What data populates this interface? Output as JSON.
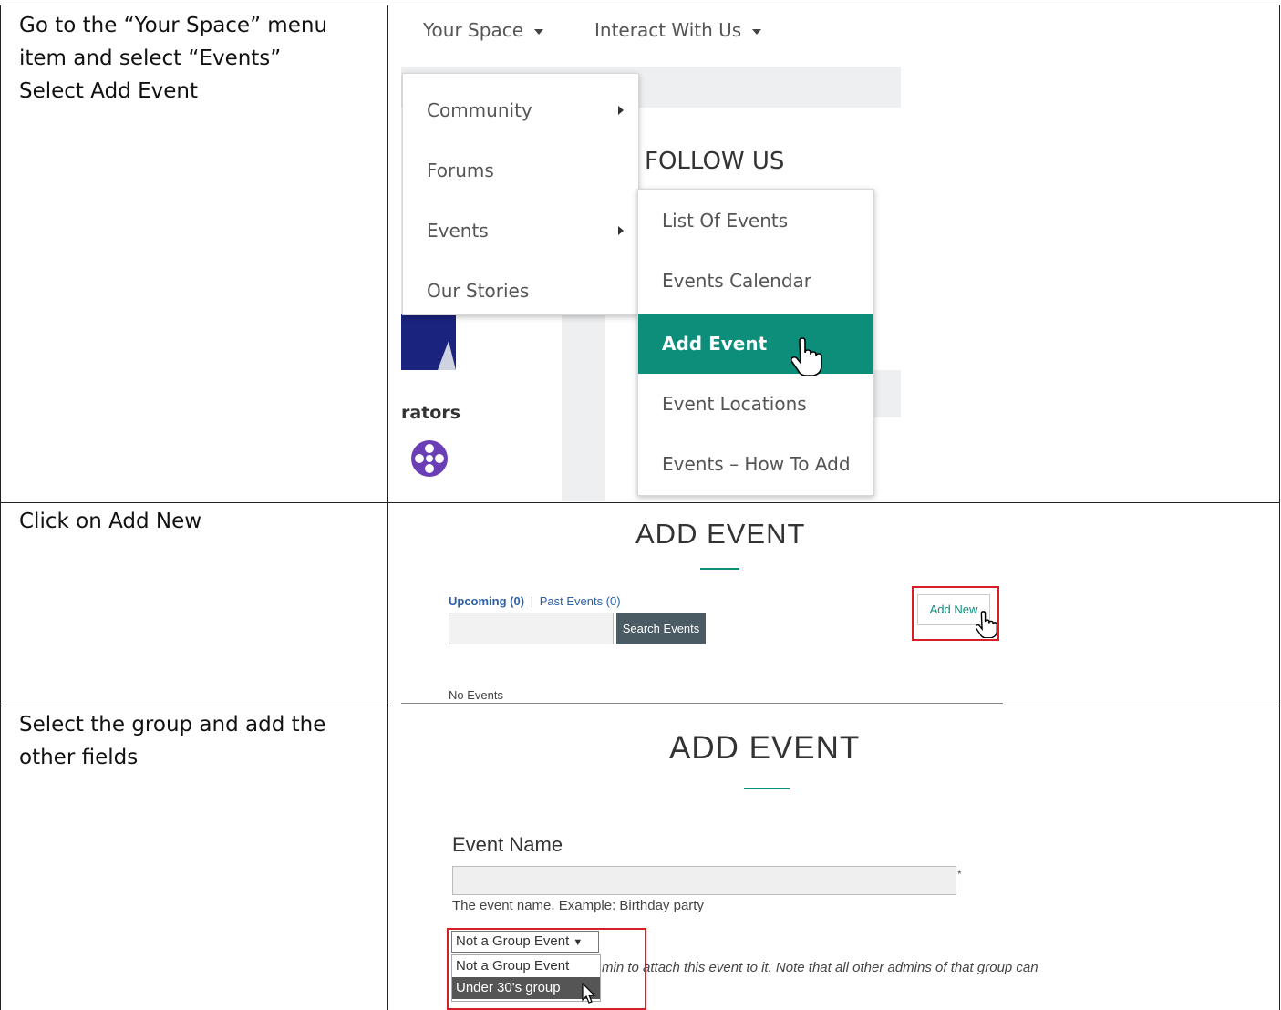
{
  "instructions": {
    "step1": [
      "Go to the “Your Space” menu",
      "item and select “Events”",
      "Select Add Event"
    ],
    "step2": "Click on Add New",
    "step3": [
      "Select the group and add the",
      "other fields"
    ]
  },
  "screenshot1": {
    "nav": {
      "your_space": "Your Space",
      "interact": "Interact With Us"
    },
    "menu": [
      "Community",
      "Forums",
      "Events",
      "Our Stories"
    ],
    "follow_us": "FOLLOW US",
    "background_text": "rators",
    "submenu": [
      "List Of Events",
      "Events Calendar",
      "Add Event",
      "Event Locations",
      "Events – How To Add"
    ],
    "colors": {
      "active": "#0d8e7b",
      "highlight": "#d61f26"
    }
  },
  "screenshot2": {
    "title": "ADD EVENT",
    "upcoming": "Upcoming (0)",
    "separator": "|",
    "past": "Past Events (0)",
    "search_button": "Search Events",
    "add_new": "Add New",
    "no_events": "No Events"
  },
  "screenshot3": {
    "title": "ADD EVENT",
    "event_name_label": "Event Name",
    "required_mark": "*",
    "help_text": "The event name. Example: Birthday party",
    "group_select_value": "Not a Group Event",
    "group_options": [
      "Not a Group Event",
      "Under 30's group"
    ],
    "partial_note": "min to attach this event to it. Note that all other admins of that group can"
  }
}
